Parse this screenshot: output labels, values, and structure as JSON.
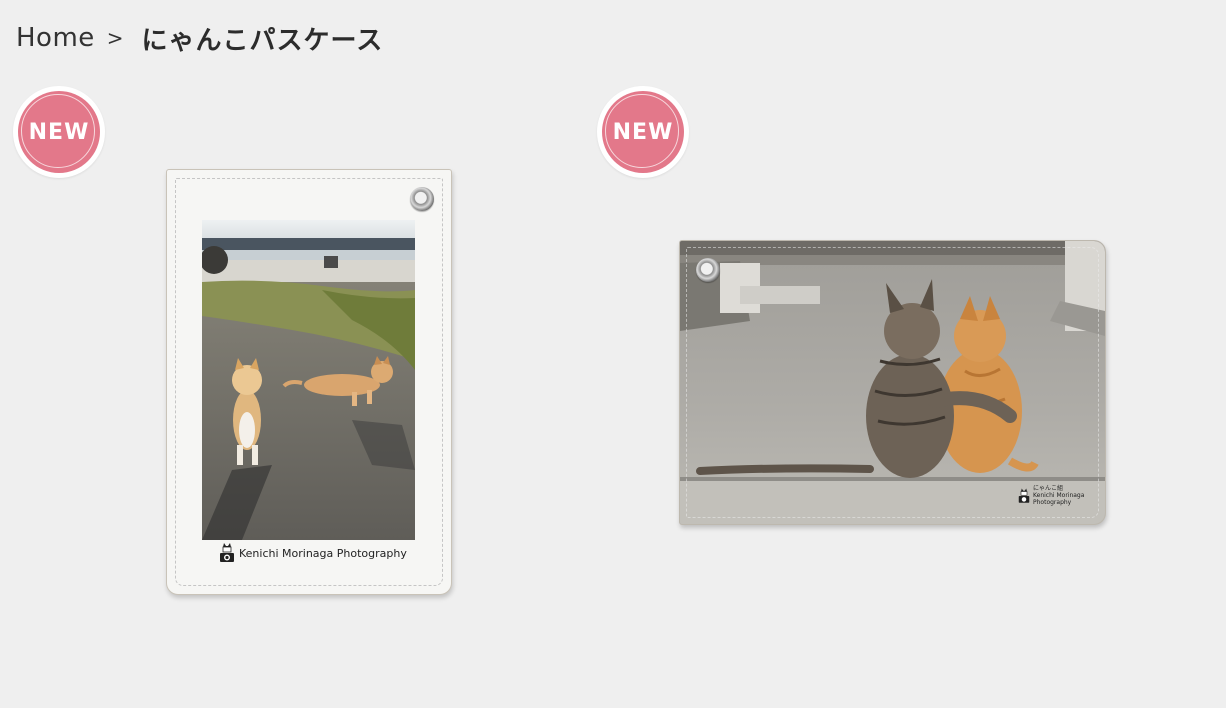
{
  "breadcrumb": {
    "home": "Home",
    "separator": ">",
    "current": "にゃんこパスケース"
  },
  "products": [
    {
      "badge": "NEW",
      "credit": "Kenichi Morinaga Photography",
      "orientation": "vertical"
    },
    {
      "badge": "NEW",
      "credit_lines": [
        "にゃんこ組",
        "Kenichi Morinaga",
        "Photography"
      ],
      "orientation": "horizontal"
    }
  ],
  "colors": {
    "background": "#efefef",
    "badge": "#e3788a",
    "badge_ring": "#ffffff"
  },
  "icons": {
    "badge": "new-badge-icon",
    "grommet": "grommet-icon",
    "credit": "cat-camera-icon"
  }
}
